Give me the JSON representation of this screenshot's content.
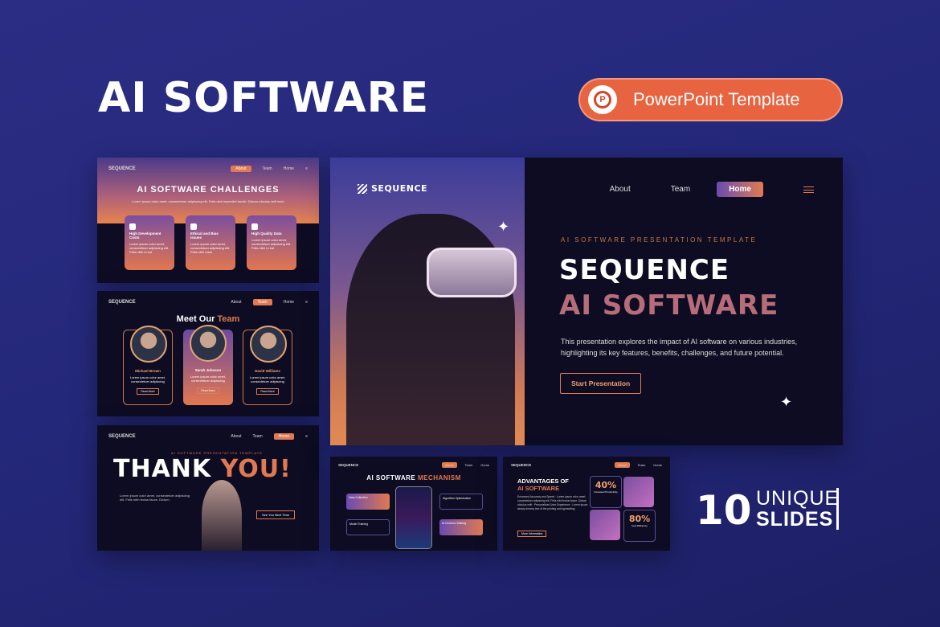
{
  "header": {
    "title": "AI SOFTWARE",
    "badge_icon": "powerpoint-icon",
    "badge_label": "PowerPoint Template"
  },
  "main_slide": {
    "logo": "SEQUENCE",
    "nav": [
      "About",
      "Team",
      "Home"
    ],
    "kicker": "AI SOFTWARE PRESENTATION TEMPLATE",
    "headline_1": "SEQUENCE",
    "headline_2": "AI SOFTWARE",
    "description": "This presentation explores the impact of AI software on various industries, highlighting its key features, benefits, challenges, and future potential.",
    "cta": "Start Presentation",
    "accent": "#e07a52"
  },
  "slide_challenges": {
    "logo": "SEQUENCE",
    "nav": [
      "About",
      "Team",
      "Home"
    ],
    "title": "AI SOFTWARE CHALLENGES",
    "subtitle": "Lorem ipsum dolor amet, consectetuer adipiscing elit. Felis nibh imperdiet faucib. Dictum rdiculus velit lectu",
    "cards": [
      {
        "title": "High Development Costs",
        "text": "Lorem ipsum color amet, consectetuer adipiscing elit. Felis nibh m est"
      },
      {
        "title": "Ethical and Bias Issues",
        "text": "Lorem ipsum color amet, consectetuer adipiscing elit. Felis nibh mest"
      },
      {
        "title": "High Quality Data",
        "text": "Lorem ipsum color amet, consectetuer adipiscing elit. Felis nibh m est"
      }
    ]
  },
  "slide_team": {
    "logo": "SEQUENCE",
    "nav": [
      "About",
      "Team",
      "Home"
    ],
    "title_a": "Meet Our ",
    "title_b": "Team",
    "members": [
      {
        "name": "Michael Brown",
        "text": "Lorem ipsum color amet, consectetuer adipiscing",
        "btn": "Read More"
      },
      {
        "name": "Sarah Johnson",
        "text": "Lorem ipsum color amet, consectetuer adipiscing",
        "btn": "Read More"
      },
      {
        "name": "David Williams",
        "text": "Lorem ipsum color amet, consectetuer adipiscing",
        "btn": "Read More"
      }
    ]
  },
  "slide_thanks": {
    "logo": "SEQUENCE",
    "nav": [
      "About",
      "Team",
      "Home"
    ],
    "kicker": "AI SOFTWARE PRESENTATION TEMPLATE",
    "title_a": "THANK ",
    "title_b": "YOU!",
    "body": "Lorem ipsum color amet, consectetuer adipiscing elit. Felis nibh lectus fauce. Dictum",
    "btn": "See You Next Time"
  },
  "slide_mechanism": {
    "logo": "SEQUENCE",
    "nav": [
      "About",
      "Team",
      "Home"
    ],
    "title_a": "AI SOFTWARE ",
    "title_b": "MECHANISM",
    "boxes": [
      "Data Collection",
      "Model Training",
      "Algorithm Optimization",
      "AI Decision Making"
    ]
  },
  "slide_advantages": {
    "logo": "SEQUENCE",
    "nav": [
      "About",
      "Team",
      "Home"
    ],
    "title_a": "ADVANTAGES OF",
    "title_b": "AI SOFTWARE",
    "list": "Enhanced Accuracy and Speed · Lorem ipsum color amet, consectetuer adipiscing elit. Felis nibh lectus fauce. Dictum rdiculus velit · Personalized User Experience · Lorem ipsum simply dummy text of the printing and typesetting",
    "more": "More Information",
    "stats": [
      {
        "value": "40%",
        "label": "Increased Productivity"
      },
      {
        "value": "80%",
        "label": "Cost Efficiency"
      }
    ]
  },
  "footer": {
    "count": "10",
    "line1": "UNIQUE",
    "line2": "SLIDES"
  }
}
